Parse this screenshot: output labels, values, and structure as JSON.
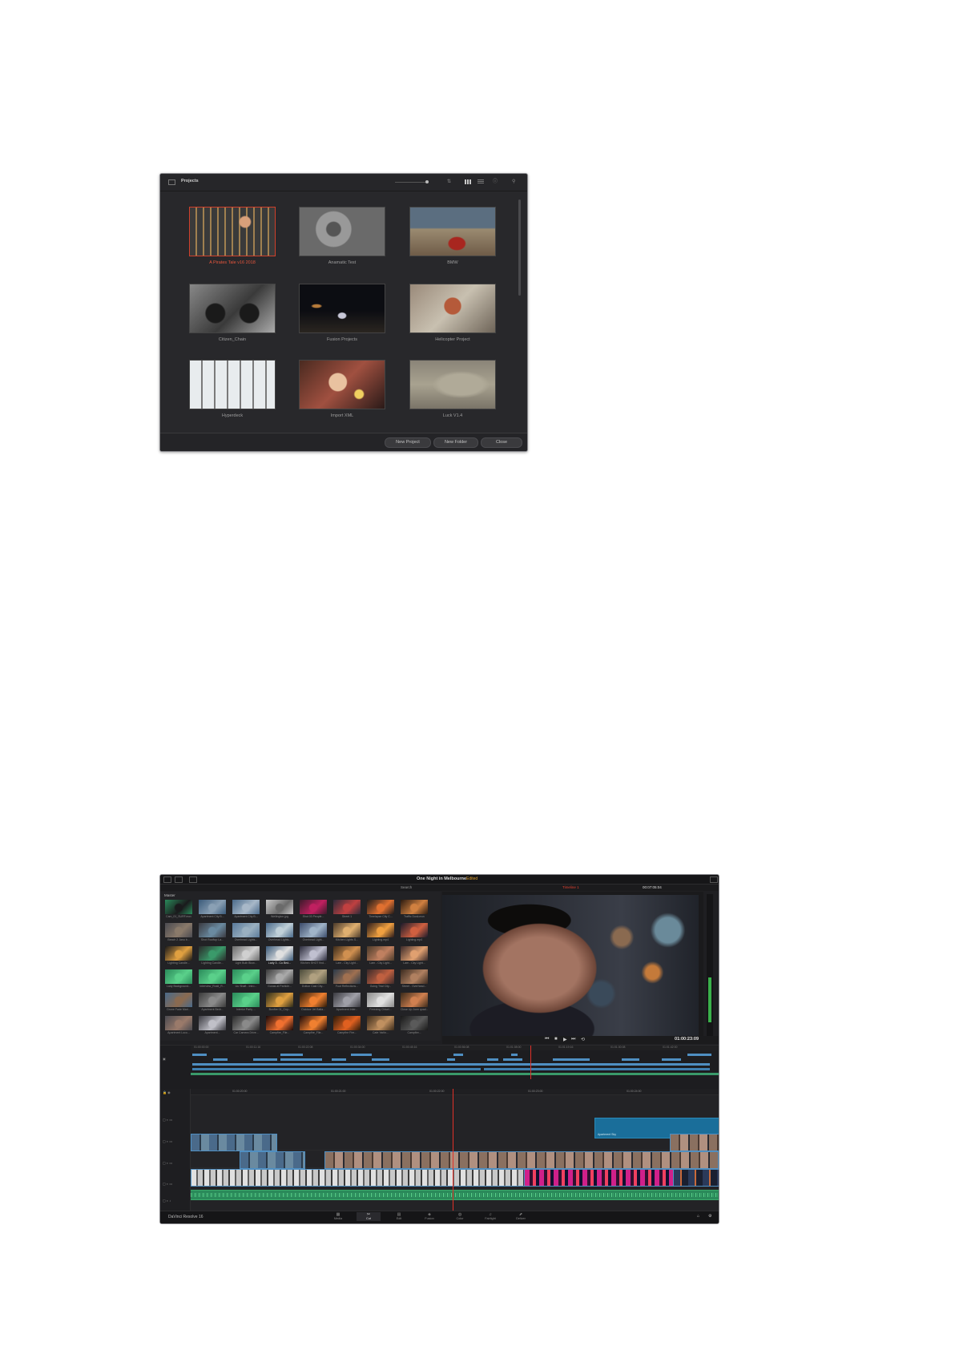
{
  "project_manager": {
    "title": "Projects",
    "projects": [
      {
        "name": "A Pirates Tale v16 2018",
        "selected": true
      },
      {
        "name": "Anamatic Test",
        "selected": false
      },
      {
        "name": "BMW",
        "selected": false
      },
      {
        "name": "Citizen_Chain",
        "selected": false
      },
      {
        "name": "Fusion Projects",
        "selected": false
      },
      {
        "name": "Helicopter Project",
        "selected": false
      },
      {
        "name": "Hyperdeck",
        "selected": false
      },
      {
        "name": "Import XML",
        "selected": false
      },
      {
        "name": "Luck V1.4",
        "selected": false
      }
    ],
    "buttons": {
      "new_project": "New Project",
      "new_folder": "New Folder",
      "close": "Close"
    }
  },
  "resolve": {
    "project_title": "One Night in Melbourne",
    "edited": "Edited",
    "search": "Search",
    "bin": "Master",
    "timeline_name": "Timeline 1",
    "source_tc": "00:07:05:04",
    "timecode": "01:00:23:09",
    "brand": "DaVinci Resolve 16",
    "clips": [
      "Cam_01_SURF.mov",
      "Apartment City B...",
      "Apartment City B...",
      "Wellington.jpg",
      "Shot 03 People...",
      "Street 1",
      "Timelapse City C...",
      "Traffic Dusk.mov",
      "Beach 2 Janu b...",
      "Shot Rooftop La...",
      "Overhead Lights...",
      "Overhead Lights...",
      "Overhead Light...",
      "Kitchen Lights S...",
      "Lighting.mp4",
      "Lighting.mp4",
      "Lighting Candle...",
      "Lighting Candle...",
      "Light Bulb Blow...",
      "Lady 3 - Cu Bed...",
      "Kitchen SHOT find...",
      "Lam - Cky Light...",
      "Lam - Cky Light...",
      "Lam - Cky Light...",
      "Lady Background...",
      "Interview_Rosti_R...",
      "Liu Shaft - Intro...",
      "Gunas at Particle...",
      "Dutton Cast City...",
      "Foot Reflections...",
      "Going Trial City...",
      "Street - Overhead...",
      "Drone Fade Mari...",
      "Apartment Bedr...",
      "Interior Party ...",
      "Bonfire 01_Cny...",
      "Outdoor Jet Balla...",
      "Apartment Inter...",
      "Freezing Chisel...",
      "Close Up Jonn quad...",
      "Apartment Loco...",
      "Apartment...",
      "Car Camera Drive...",
      "Campfire_Flie...",
      "Campfire_Flie...",
      "Campfire Fire...",
      "Cafe Yarlin...",
      "Campfire..."
    ],
    "upper_ruler": [
      "01:00:00:00",
      "01:00:11:16",
      "01:00:22:08",
      "01:00:34:00",
      "01:00:45:16",
      "01:00:56:08",
      "01:01:08:00",
      "01:01:19:16",
      "01:01:30:08",
      "01:01:42:00"
    ],
    "lower_ruler": [
      "01:00:20:00",
      "01:00:21:00",
      "01:00:22:00",
      "01:00:23:00",
      "01:00:24:00"
    ],
    "title_clip": "Apartment Sky",
    "pages": [
      "Media",
      "Cut",
      "Edit",
      "Fusion",
      "Color",
      "Fairlight",
      "Deliver"
    ],
    "active_page": "Cut"
  }
}
